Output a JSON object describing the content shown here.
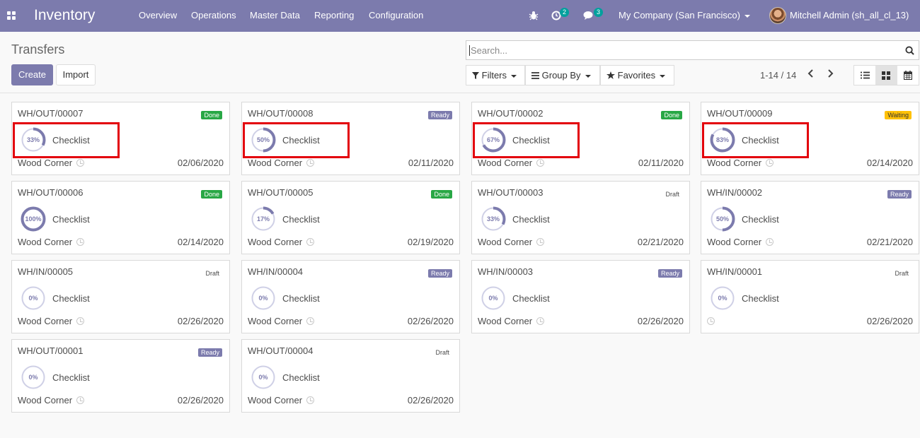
{
  "navbar": {
    "brand": "Inventory",
    "menu": [
      "Overview",
      "Operations",
      "Master Data",
      "Reporting",
      "Configuration"
    ],
    "activities_count": "2",
    "messages_count": "3",
    "company": "My Company (San Francisco)",
    "user": "Mitchell Admin (sh_all_cl_13)"
  },
  "control": {
    "title": "Transfers",
    "create_label": "Create",
    "import_label": "Import",
    "search_placeholder": "Search...",
    "filters_label": "Filters",
    "groupby_label": "Group By",
    "favorites_label": "Favorites",
    "pager": "1-14 / 14"
  },
  "colors": {
    "brand": "#7c7bad",
    "done": "#28a745",
    "waiting": "#ffc107",
    "highlight": "#e3000b"
  },
  "cards": [
    {
      "ref": "WH/OUT/00007",
      "status": "Done",
      "status_class": "done",
      "progress_pct": 33,
      "progress": "33%",
      "checklist": "Checklist",
      "partner": "Wood Corner",
      "date": "02/06/2020",
      "highlighted": true
    },
    {
      "ref": "WH/OUT/00008",
      "status": "Ready",
      "status_class": "ready",
      "progress_pct": 50,
      "progress": "50%",
      "checklist": "Checklist",
      "partner": "Wood Corner",
      "date": "02/11/2020",
      "highlighted": true
    },
    {
      "ref": "WH/OUT/00002",
      "status": "Done",
      "status_class": "done",
      "progress_pct": 67,
      "progress": "67%",
      "checklist": "Checklist",
      "partner": "Wood Corner",
      "date": "02/11/2020",
      "highlighted": true
    },
    {
      "ref": "WH/OUT/00009",
      "status": "Waiting",
      "status_class": "waiting",
      "progress_pct": 83,
      "progress": "83%",
      "checklist": "Checklist",
      "partner": "Wood Corner",
      "date": "02/14/2020",
      "highlighted": true
    },
    {
      "ref": "WH/OUT/00006",
      "status": "Done",
      "status_class": "done",
      "progress_pct": 100,
      "progress": "100%",
      "checklist": "Checklist",
      "partner": "Wood Corner",
      "date": "02/14/2020",
      "highlighted": false
    },
    {
      "ref": "WH/OUT/00005",
      "status": "Done",
      "status_class": "done",
      "progress_pct": 17,
      "progress": "17%",
      "checklist": "Checklist",
      "partner": "Wood Corner",
      "date": "02/19/2020",
      "highlighted": false
    },
    {
      "ref": "WH/OUT/00003",
      "status": "Draft",
      "status_class": "draft",
      "progress_pct": 33,
      "progress": "33%",
      "checklist": "Checklist",
      "partner": "Wood Corner",
      "date": "02/21/2020",
      "highlighted": false
    },
    {
      "ref": "WH/IN/00002",
      "status": "Ready",
      "status_class": "ready",
      "progress_pct": 50,
      "progress": "50%",
      "checklist": "Checklist",
      "partner": "Wood Corner",
      "date": "02/21/2020",
      "highlighted": false
    },
    {
      "ref": "WH/IN/00005",
      "status": "Draft",
      "status_class": "draft",
      "progress_pct": 0,
      "progress": "0%",
      "checklist": "Checklist",
      "partner": "Wood Corner",
      "date": "02/26/2020",
      "highlighted": false
    },
    {
      "ref": "WH/IN/00004",
      "status": "Ready",
      "status_class": "ready",
      "progress_pct": 0,
      "progress": "0%",
      "checklist": "Checklist",
      "partner": "Wood Corner",
      "date": "02/26/2020",
      "highlighted": false
    },
    {
      "ref": "WH/IN/00003",
      "status": "Ready",
      "status_class": "ready",
      "progress_pct": 0,
      "progress": "0%",
      "checklist": "Checklist",
      "partner": "Wood Corner",
      "date": "02/26/2020",
      "highlighted": false
    },
    {
      "ref": "WH/IN/00001",
      "status": "Draft",
      "status_class": "draft",
      "progress_pct": 0,
      "progress": "0%",
      "checklist": "Checklist",
      "partner": "",
      "date": "02/26/2020",
      "highlighted": false
    },
    {
      "ref": "WH/OUT/00001",
      "status": "Ready",
      "status_class": "ready",
      "progress_pct": 0,
      "progress": "0%",
      "checklist": "Checklist",
      "partner": "Wood Corner",
      "date": "02/26/2020",
      "highlighted": false
    },
    {
      "ref": "WH/OUT/00004",
      "status": "Draft",
      "status_class": "draft",
      "progress_pct": 0,
      "progress": "0%",
      "checklist": "Checklist",
      "partner": "Wood Corner",
      "date": "02/26/2020",
      "highlighted": false
    }
  ]
}
